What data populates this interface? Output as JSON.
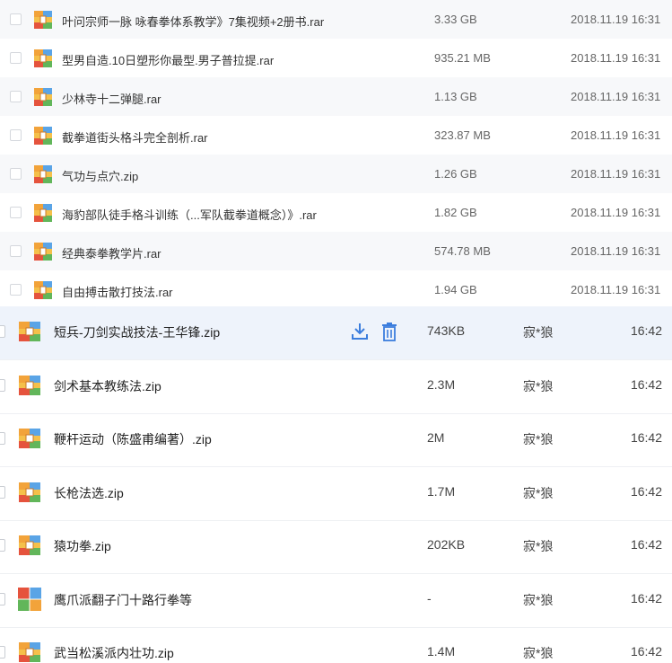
{
  "top_files": [
    {
      "name": "叶问宗师一脉 咏春拳体系教学》7集视频+2册书.rar",
      "size": "3.33 GB",
      "date": "2018.11.19 16:31"
    },
    {
      "name": "型男自造.10日塑形你最型.男子普拉提.rar",
      "size": "935.21 MB",
      "date": "2018.11.19 16:31"
    },
    {
      "name": "少林寺十二弹腿.rar",
      "size": "1.13 GB",
      "date": "2018.11.19 16:31"
    },
    {
      "name": "截拳道街头格斗完全剖析.rar",
      "size": "323.87 MB",
      "date": "2018.11.19 16:31"
    },
    {
      "name": "气功与点穴.zip",
      "size": "1.26 GB",
      "date": "2018.11.19 16:31"
    },
    {
      "name": "海豹部队徒手格斗训练（...军队截拳道概念）》.rar",
      "size": "1.82 GB",
      "date": "2018.11.19 16:31"
    },
    {
      "name": "经典泰拳教学片.rar",
      "size": "574.78 MB",
      "date": "2018.11.19 16:31"
    },
    {
      "name": "自由搏击散打技法.rar",
      "size": "1.94 GB",
      "date": "2018.11.19 16:31"
    }
  ],
  "bottom_files": [
    {
      "name": "短兵-刀剑实战技法-王华锋.zip",
      "size": "743KB",
      "owner": "寂*狼",
      "time": "16:42",
      "selected": true,
      "icon": "archive-icon"
    },
    {
      "name": "剑术基本教练法.zip",
      "size": "2.3M",
      "owner": "寂*狼",
      "time": "16:42",
      "icon": "archive-icon"
    },
    {
      "name": "鞭杆运动（陈盛甫编著）.zip",
      "size": "2M",
      "owner": "寂*狼",
      "time": "16:42",
      "icon": "archive-icon"
    },
    {
      "name": "长枪法选.zip",
      "size": "1.7M",
      "owner": "寂*狼",
      "time": "16:42",
      "icon": "archive-icon"
    },
    {
      "name": "猿功拳.zip",
      "size": "202KB",
      "owner": "寂*狼",
      "time": "16:42",
      "icon": "archive-icon"
    },
    {
      "name": "鹰爪派翻子门十路行拳等",
      "size": "-",
      "owner": "寂*狼",
      "time": "16:42",
      "icon": "folder-grid-icon"
    },
    {
      "name": "武当松溪派内壮功.zip",
      "size": "1.4M",
      "owner": "寂*狼",
      "time": "16:42",
      "icon": "archive-icon"
    }
  ],
  "colors": {
    "accent": "#3b7ddd",
    "row_alt": "#f7f8fa",
    "row_selected": "#eef3fb"
  }
}
